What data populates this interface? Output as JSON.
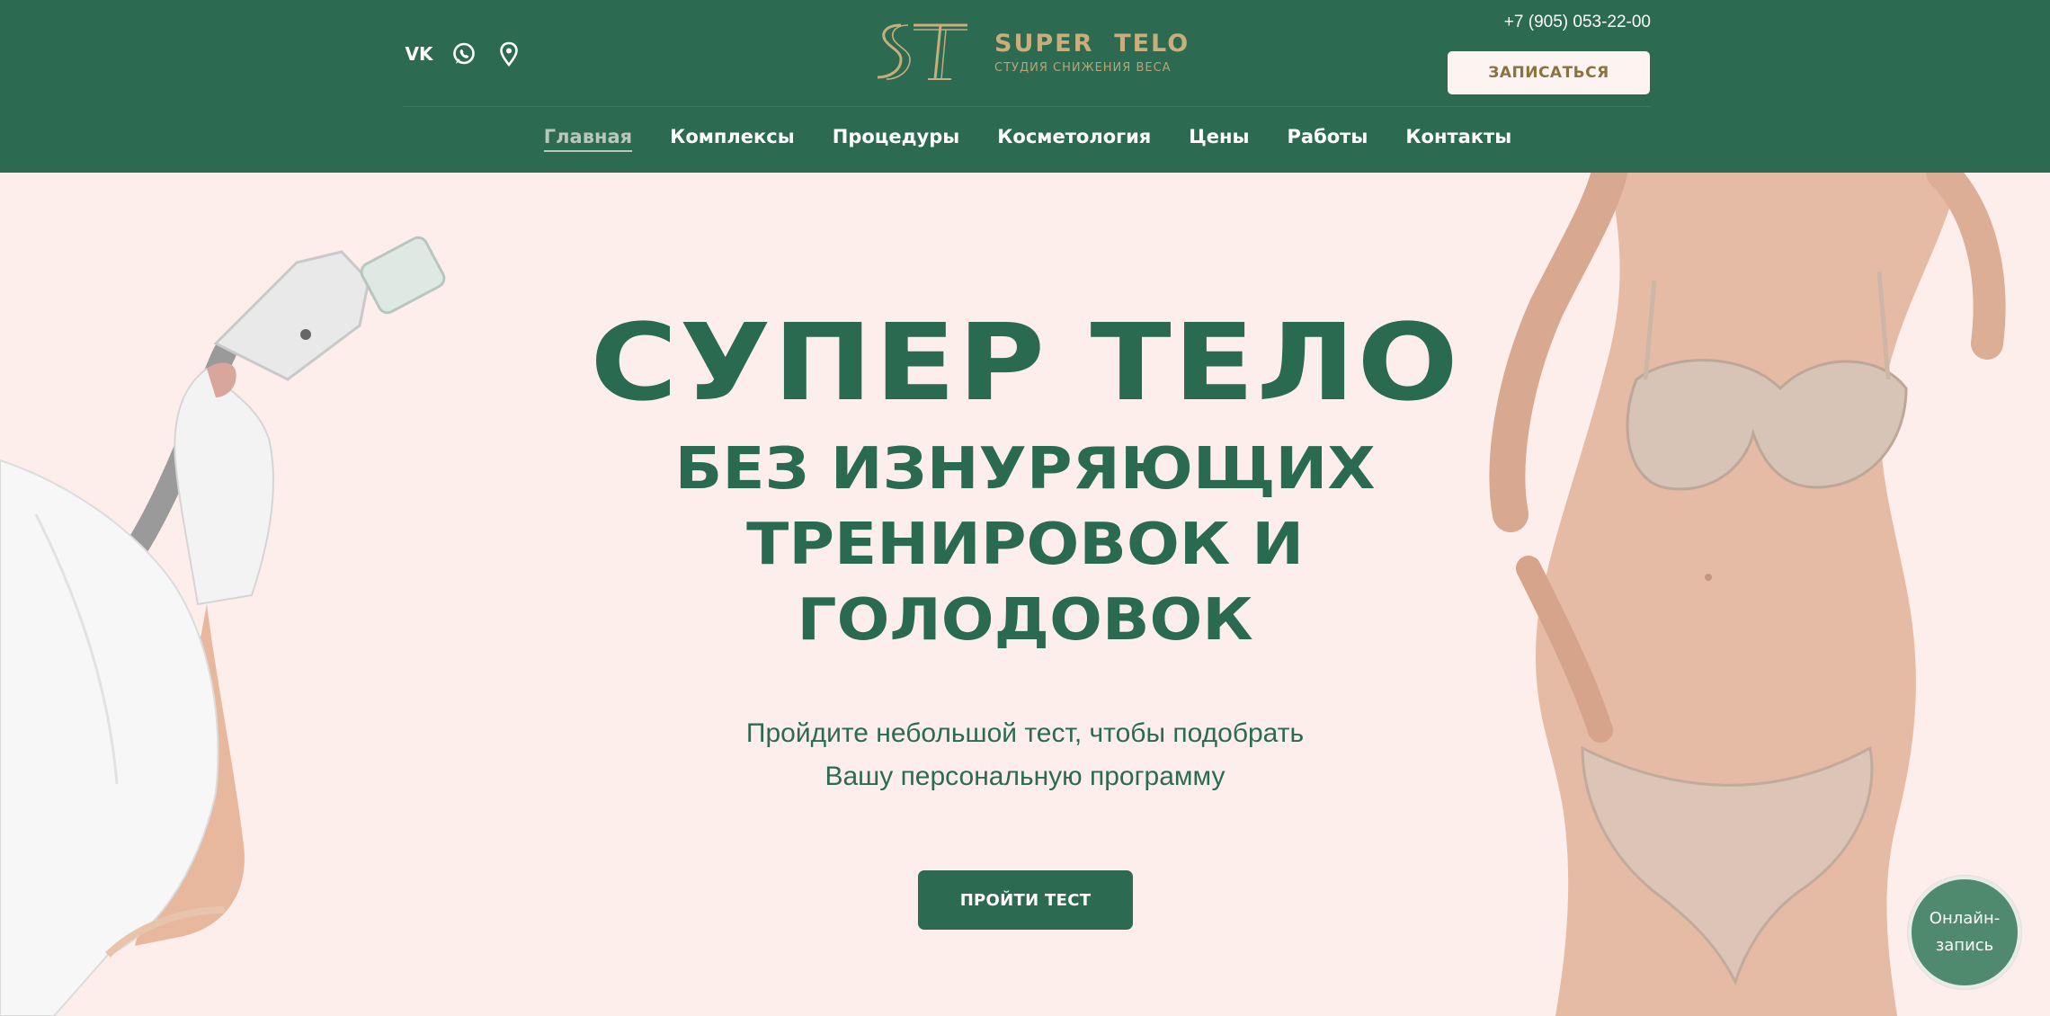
{
  "header": {
    "phone": "+7 (905) 053-22-00",
    "signup_label": "ЗАПИСАТЬСЯ",
    "social": [
      {
        "icon": "vk-icon",
        "label": "VK"
      },
      {
        "icon": "whatsapp-icon"
      },
      {
        "icon": "map-pin-icon"
      }
    ],
    "logo": {
      "mark": "ST",
      "name": "SUPER  TELO",
      "subtitle": "СТУДИЯ СНИЖЕНИЯ ВЕСА"
    }
  },
  "nav": {
    "items": [
      {
        "label": "Главная",
        "active": true
      },
      {
        "label": "Комплексы"
      },
      {
        "label": "Процедуры"
      },
      {
        "label": "Косметология"
      },
      {
        "label": "Цены"
      },
      {
        "label": "Работы"
      },
      {
        "label": "Контакты"
      }
    ]
  },
  "hero": {
    "title": "СУПЕР ТЕЛО",
    "subtitle_lines": [
      "БЕЗ ИЗНУРЯЮЩИХ",
      "ТРЕНИРОВОК И",
      "ГОЛОДОВОК"
    ],
    "lead_lines": [
      "Пройдите небольшой тест, чтобы подобрать",
      "Вашу персональную программу"
    ],
    "cta_label": "ПРОЙТИ ТЕСТ"
  },
  "widget": {
    "line1": "Онлайн-",
    "line2": "запись"
  },
  "colors": {
    "header_bg": "#2c6a52",
    "hero_bg": "#fdeeeb",
    "brand_gold": "#c8ae7c",
    "text_green": "#2a6a50"
  }
}
